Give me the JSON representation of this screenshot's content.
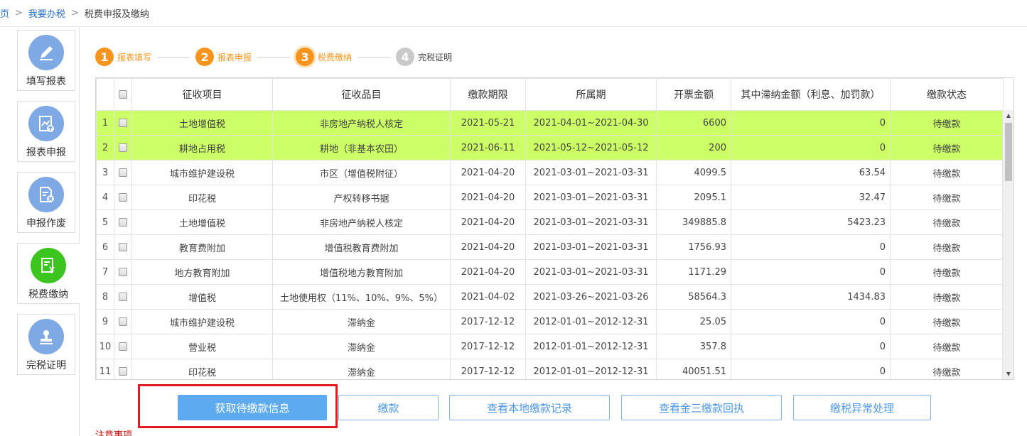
{
  "breadcrumb": {
    "home": "页",
    "level1": "我要办税",
    "level2": "税费申报及缴纳",
    "sep": ">"
  },
  "sidebar": {
    "items": [
      {
        "label": "填写报表",
        "icon": "pencil-icon",
        "active": false
      },
      {
        "label": "报表申报",
        "icon": "report-upload-icon",
        "active": false
      },
      {
        "label": "申报作废",
        "icon": "void-document-icon",
        "active": false
      },
      {
        "label": "税费缴纳",
        "icon": "tax-payment-icon",
        "active": true
      },
      {
        "label": "完税证明",
        "icon": "stamp-icon",
        "active": false
      }
    ]
  },
  "steps": [
    {
      "num": "1",
      "label": "报表填写",
      "state": "done"
    },
    {
      "num": "2",
      "label": "报表申报",
      "state": "done"
    },
    {
      "num": "3",
      "label": "税费缴纳",
      "state": "current"
    },
    {
      "num": "4",
      "label": "完税证明",
      "state": "todo"
    }
  ],
  "table": {
    "columns": [
      "征收项目",
      "征收品目",
      "缴款期限",
      "所属期",
      "开票金额",
      "其中滞纳金额（利息、加罚款）",
      "缴款状态"
    ],
    "rows": [
      {
        "no": "1",
        "item": "土地增值税",
        "category": "非房地产纳税人核定",
        "deadline": "2021-05-21",
        "period": "2021-04-01~2021-04-30",
        "amount": "6600",
        "late_fee": "0",
        "status": "待缴款",
        "highlight": true
      },
      {
        "no": "2",
        "item": "耕地占用税",
        "category": "耕地（非基本农田）",
        "deadline": "2021-06-11",
        "period": "2021-05-12~2021-05-12",
        "amount": "200",
        "late_fee": "0",
        "status": "待缴款",
        "highlight": true
      },
      {
        "no": "3",
        "item": "城市维护建设税",
        "category": "市区（增值税附征）",
        "deadline": "2021-04-20",
        "period": "2021-03-01~2021-03-31",
        "amount": "4099.5",
        "late_fee": "63.54",
        "status": "待缴款",
        "highlight": false
      },
      {
        "no": "4",
        "item": "印花税",
        "category": "产权转移书据",
        "deadline": "2021-04-20",
        "period": "2021-03-01~2021-03-31",
        "amount": "2095.1",
        "late_fee": "32.47",
        "status": "待缴款",
        "highlight": false
      },
      {
        "no": "5",
        "item": "土地增值税",
        "category": "非房地产纳税人核定",
        "deadline": "2021-04-20",
        "period": "2021-03-01~2021-03-31",
        "amount": "349885.8",
        "late_fee": "5423.23",
        "status": "待缴款",
        "highlight": false
      },
      {
        "no": "6",
        "item": "教育费附加",
        "category": "增值税教育费附加",
        "deadline": "2021-04-20",
        "period": "2021-03-01~2021-03-31",
        "amount": "1756.93",
        "late_fee": "0",
        "status": "待缴款",
        "highlight": false
      },
      {
        "no": "7",
        "item": "地方教育附加",
        "category": "增值税地方教育附加",
        "deadline": "2021-04-20",
        "period": "2021-03-01~2021-03-31",
        "amount": "1171.29",
        "late_fee": "0",
        "status": "待缴款",
        "highlight": false
      },
      {
        "no": "8",
        "item": "增值税",
        "category": "土地使用权（11%、10%、9%、5%）",
        "deadline": "2021-04-02",
        "period": "2021-03-26~2021-03-26",
        "amount": "58564.3",
        "late_fee": "1434.83",
        "status": "待缴款",
        "highlight": false
      },
      {
        "no": "9",
        "item": "城市维护建设税",
        "category": "滞纳金",
        "deadline": "2017-12-12",
        "period": "2012-01-01~2012-12-31",
        "amount": "25.05",
        "late_fee": "0",
        "status": "待缴款",
        "highlight": false
      },
      {
        "no": "10",
        "item": "营业税",
        "category": "滞纳金",
        "deadline": "2017-12-12",
        "period": "2012-01-01~2012-12-31",
        "amount": "357.8",
        "late_fee": "0",
        "status": "待缴款",
        "highlight": false
      },
      {
        "no": "11",
        "item": "印花税",
        "category": "滞纳金",
        "deadline": "2017-12-12",
        "period": "2012-01-01~2012-12-31",
        "amount": "40051.51",
        "late_fee": "0",
        "status": "待缴款",
        "highlight": false
      }
    ]
  },
  "buttons": {
    "fetch": "获取待缴款信息",
    "pay": "缴款",
    "local_records": "查看本地缴款记录",
    "jinsan_receipt": "查看金三缴款回执",
    "exception": "缴税异常处理"
  },
  "note": "注意事项",
  "colors": {
    "accent": "#f7941d",
    "highlight_row": "#ccff66",
    "primary_button": "#5eaaf0",
    "red_box": "#e01b24"
  }
}
